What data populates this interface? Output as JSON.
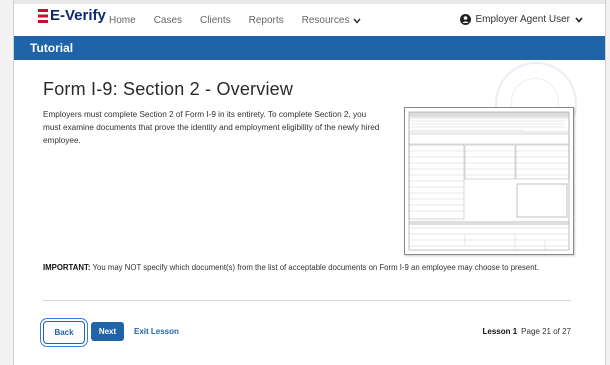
{
  "nav": {
    "logo": "E-Verify",
    "links": [
      "Home",
      "Cases",
      "Clients",
      "Reports",
      "Resources"
    ],
    "user": "Employer Agent User"
  },
  "header": {
    "title": "Tutorial"
  },
  "main": {
    "heading": "Form I-9: Section 2 - Overview",
    "intro": "Employers must complete Section 2 of Form I-9 in its entirety. To complete Section 2, you must examine documents that prove the identity and employment eligibility of the newly hired employee.",
    "important_label": "IMPORTANT:",
    "important_text": " You may NOT specify which document(s) from the list of acceptable documents on Form I-9 an employee may choose to present."
  },
  "footer": {
    "back": "Back",
    "next": "Next",
    "exit": "Exit Lesson",
    "lesson": "Lesson 1",
    "page": "Page 21 of 27"
  },
  "colors": {
    "brand": "#1f63a8",
    "logo": "#0b2a6f",
    "flag_red": "#c8102e"
  }
}
